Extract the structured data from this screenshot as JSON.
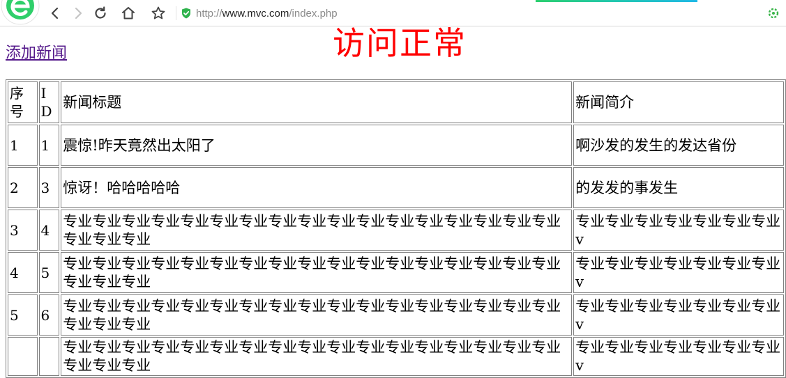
{
  "browser": {
    "url_protocol": "http://",
    "url_host": "www.mvc.com",
    "url_path": "/index.php"
  },
  "page": {
    "add_link": "添加新闻",
    "status_text": "访问正常"
  },
  "table": {
    "headers": [
      "序号",
      "ID",
      "新闻标题",
      "新闻简介"
    ],
    "rows": [
      {
        "seq": "1",
        "id": "1",
        "title": "震惊!昨天竟然出太阳了",
        "intro": "啊沙发的发生的发达省份"
      },
      {
        "seq": "2",
        "id": "3",
        "title": "惊讶！哈哈哈哈哈",
        "intro": "的发发的事发生"
      },
      {
        "seq": "3",
        "id": "4",
        "title": "专业专业专业专业专业专业专业专业专业专业专业专业专业专业专业专业专业专业专业专业",
        "intro": "专业专业专业专业专业专业专业v"
      },
      {
        "seq": "4",
        "id": "5",
        "title": "专业专业专业专业专业专业专业专业专业专业专业专业专业专业专业专业专业专业专业专业",
        "intro": "专业专业专业专业专业专业专业v"
      },
      {
        "seq": "5",
        "id": "6",
        "title": "专业专业专业专业专业专业专业专业专业专业专业专业专业专业专业专业专业专业专业专业",
        "intro": "专业专业专业专业专业专业专业v"
      }
    ],
    "partial_row": {
      "title": "专业专业专业专业专业专业专业专业专业专业专业专业专业专业专业专业专业专业专业专业",
      "intro": "专业专业专业专业专业专业专业v"
    }
  }
}
